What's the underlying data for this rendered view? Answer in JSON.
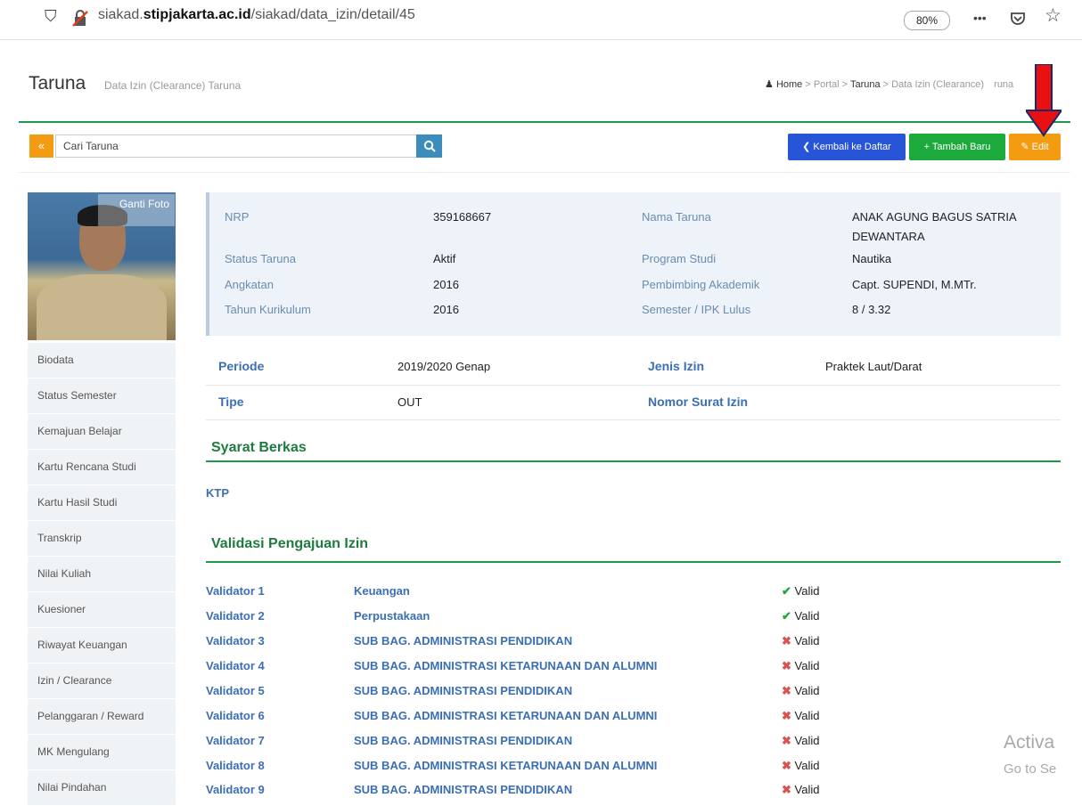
{
  "browser": {
    "url_prefix": "siakad.",
    "url_domain": "stipjakarta.ac.id",
    "url_path": "/siakad/data_izin/detail/45",
    "zoom": "80%",
    "menu_glyph": "•••",
    "pocket_glyph": "☑",
    "star_glyph": "☆",
    "shield_glyph": "⛉"
  },
  "header": {
    "title": "Taruna",
    "subtitle": "Data Izin (Clearance) Taruna",
    "breadcrumb": [
      "Home",
      ">",
      "Portal",
      ">",
      "Taruna",
      ">",
      "Data Izin (Clearance)",
      "runa"
    ]
  },
  "toolbar": {
    "collapse_glyph": "«",
    "search_placeholder": "Cari Taruna",
    "search_glyph": "Q",
    "back_label": "❮ Kembali ke Daftar",
    "add_label": "+ Tambah Baru",
    "edit_label": "✎ Edit"
  },
  "photo": {
    "change_label": "Ganti Foto"
  },
  "sidebar": {
    "items": [
      "Biodata",
      "Status Semester",
      "Kemajuan Belajar",
      "Kartu Rencana Studi",
      "Kartu Hasil Studi",
      "Transkrip",
      "Nilai Kuliah",
      "Kuesioner",
      "Riwayat Keuangan",
      "Izin / Clearance",
      "Pelanggaran / Reward",
      "MK Mengulang",
      "Nilai Pindahan"
    ]
  },
  "profile": {
    "nrp_label": "NRP",
    "nrp": "359168667",
    "nama_label": "Nama Taruna",
    "nama_line1": "ANAK AGUNG BAGUS SATRIA",
    "nama_line2": "DEWANTARA",
    "status_label": "Status Taruna",
    "status": "Aktif",
    "prodi_label": "Program Studi",
    "prodi": "Nautika",
    "angkatan_label": "Angkatan",
    "angkatan": "2016",
    "pa_label": "Pembimbing Akademik",
    "pa": "Capt. SUPENDI, M.MTr.",
    "kurikulum_label": "Tahun Kurikulum",
    "kurikulum": "2016",
    "ipk_label": "Semester / IPK Lulus",
    "ipk": "8 / 3.32"
  },
  "detail": {
    "periode_label": "Periode",
    "periode": "2019/2020 Genap",
    "jenis_label": "Jenis Izin",
    "jenis": "Praktek Laut/Darat",
    "tipe_label": "Tipe",
    "tipe": "OUT",
    "nomor_label": "Nomor Surat Izin"
  },
  "berkas": {
    "title": "Syarat Berkas",
    "items": [
      "KTP"
    ]
  },
  "validasi": {
    "title": "Validasi Pengajuan Izin",
    "rows": [
      {
        "validator": "Validator 1",
        "unit": "Keuangan",
        "status": "Valid",
        "ok": true
      },
      {
        "validator": "Validator 2",
        "unit": "Perpustakaan",
        "status": "Valid",
        "ok": true
      },
      {
        "validator": "Validator 3",
        "unit": "SUB BAG. ADMINISTRASI PENDIDIKAN",
        "status": "Valid",
        "ok": false
      },
      {
        "validator": "Validator 4",
        "unit": "SUB BAG. ADMINISTRASI KETARUNAAN DAN ALUMNI",
        "status": "Valid",
        "ok": false
      },
      {
        "validator": "Validator 5",
        "unit": "SUB BAG. ADMINISTRASI PENDIDIKAN",
        "status": "Valid",
        "ok": false
      },
      {
        "validator": "Validator 6",
        "unit": "SUB BAG. ADMINISTRASI KETARUNAAN DAN ALUMNI",
        "status": "Valid",
        "ok": false
      },
      {
        "validator": "Validator 7",
        "unit": "SUB BAG. ADMINISTRASI PENDIDIKAN",
        "status": "Valid",
        "ok": false
      },
      {
        "validator": "Validator 8",
        "unit": "SUB BAG. ADMINISTRASI KETARUNAAN DAN ALUMNI",
        "status": "Valid",
        "ok": false
      },
      {
        "validator": "Validator 9",
        "unit": "SUB BAG. ADMINISTRASI PENDIDIKAN",
        "status": "Valid",
        "ok": false
      }
    ],
    "ok_glyph": "✔",
    "no_glyph": "✖"
  },
  "watermark": {
    "line1": "Activa",
    "line2": "Go to Se"
  },
  "colors": {
    "green": "#1c9a4c",
    "blue_btn": "#2855d8",
    "orange": "#f39c12",
    "link_blue": "#3c6eb4"
  }
}
